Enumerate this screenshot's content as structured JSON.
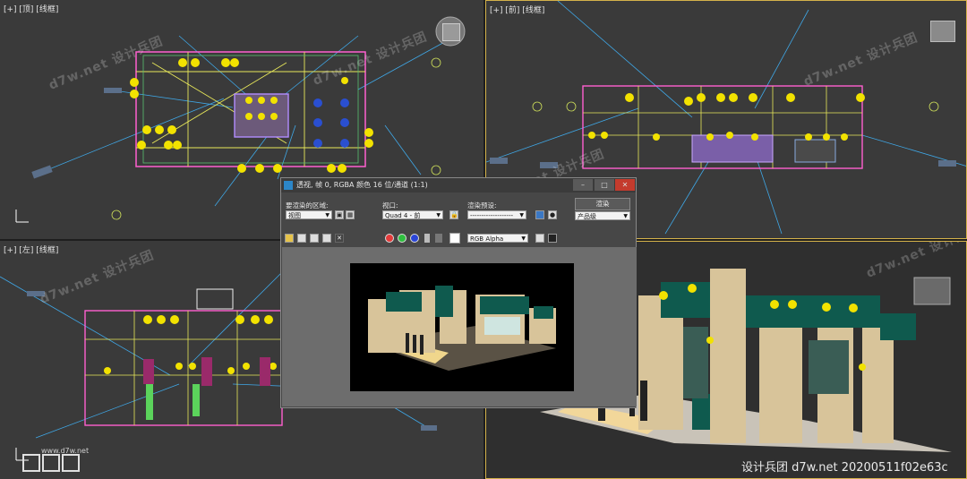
{
  "viewports": {
    "top": {
      "label": "[+] [顶] [线框]"
    },
    "front": {
      "label": "[+] [前] [线框]"
    },
    "left": {
      "label": "[+] [左] [线框]"
    },
    "perspective": {
      "label": ""
    }
  },
  "watermark_text": "d7w.net 设计兵团",
  "render_dialog": {
    "title": "透视, 帧 0, RGBA 颜色 16 位/通道 (1:1)",
    "area_label": "要渲染的区域:",
    "area_value": "视图",
    "viewport_label": "视口:",
    "viewport_value": "Quad 4 - 前",
    "preset_label": "渲染预设:",
    "preset_value": "-------------------",
    "render_button": "渲染",
    "product_level": "产品级",
    "channel_value": "RGB Alpha"
  },
  "footer": {
    "credit": "设计兵团  d7w.net  20200511f02e63c",
    "logo_sub": "www.d7w.net",
    "logo_text": "设计兵团"
  },
  "colors": {
    "viewport_bg": "#3a3a3a",
    "active_border": "#d4b24a",
    "dialog_bg": "#474747",
    "booth_green": "#0f5a4e",
    "booth_beige": "#d8c49a"
  }
}
